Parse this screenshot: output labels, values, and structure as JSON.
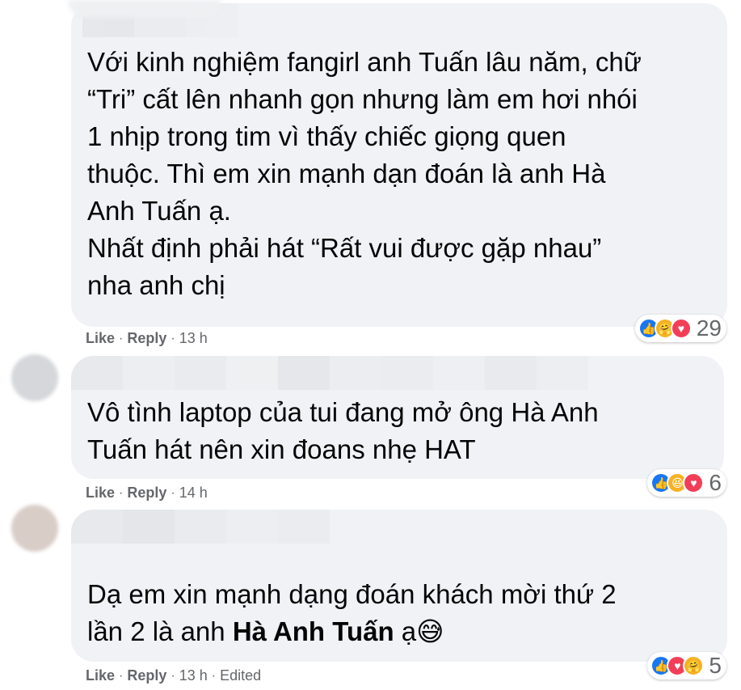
{
  "comments": [
    {
      "text": "Với kinh nghiệm fangirl anh Tuấn lâu năm, chữ\n“Tri” cất lên nhanh gọn nhưng làm em hơi nhói\n1 nhịp trong tim vì thấy chiếc giọng quen\nthuộc. Thì em xin mạnh dạn đoán là anh Hà\nAnh Tuấn ạ.\nNhất định phải hát “Rất vui được gặp nhau”\nnha anh chị",
      "like": "Like",
      "reply": "Reply",
      "time": "13 h",
      "reaction_count": "29",
      "reactions": [
        "like",
        "care",
        "heart"
      ]
    },
    {
      "text": "Vô tình laptop của tui đang mở ông Hà Anh\nTuấn hát nên xin đoans nhẹ HAT",
      "like": "Like",
      "reply": "Reply",
      "time": "14 h",
      "reaction_count": "6",
      "reactions": [
        "like",
        "haha",
        "heart"
      ]
    },
    {
      "text_part1": "Dạ em xin mạnh dạng đoán khách mời thứ 2\nlần 2 là anh ",
      "text_bold": "Hà Anh Tuấn",
      "text_part2": " ạ😅",
      "like": "Like",
      "reply": "Reply",
      "time": "13 h",
      "edited": "Edited",
      "reaction_count": "5",
      "reactions": [
        "like",
        "heart",
        "care"
      ]
    }
  ],
  "colors": {
    "bubble": "#f0f2f5",
    "meta": "#65676b",
    "like": "#1877f2",
    "heart": "#f33e58",
    "care": "#f7b125"
  }
}
